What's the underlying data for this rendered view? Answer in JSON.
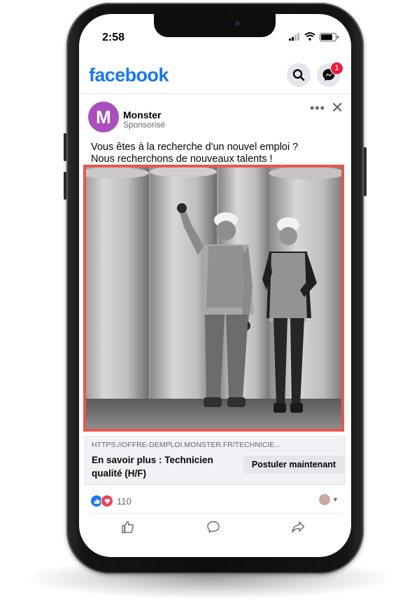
{
  "status_bar": {
    "time": "2:58"
  },
  "header": {
    "logo": "facebook",
    "search_icon": "search-icon",
    "messenger_icon": "messenger-icon",
    "notification_count": "1"
  },
  "post": {
    "author": "Monster",
    "author_initial": "M",
    "sponsored_label": "Sponsorisé",
    "text_line1": "Vous êtes à la recherche d'un nouvel emploi ?",
    "text_line2": "Nous recherchons de nouveaux talents !",
    "link_url": "HTTPS://OFFRE-DEMPLOI.MONSTER.FR/TECHNICIE...",
    "link_title": "En savoir plus : Technicien qualité (H/F)",
    "cta_label": "Postuler maintenant",
    "reaction_count": "110"
  },
  "actions": {
    "like_icon": "thumbs-up-icon",
    "comment_icon": "comment-icon",
    "share_icon": "share-icon"
  },
  "colors": {
    "facebook_blue": "#1877f2",
    "avatar_purple": "#a94ebc",
    "highlight_red": "#e8574d",
    "badge_red": "#e41e3f"
  }
}
